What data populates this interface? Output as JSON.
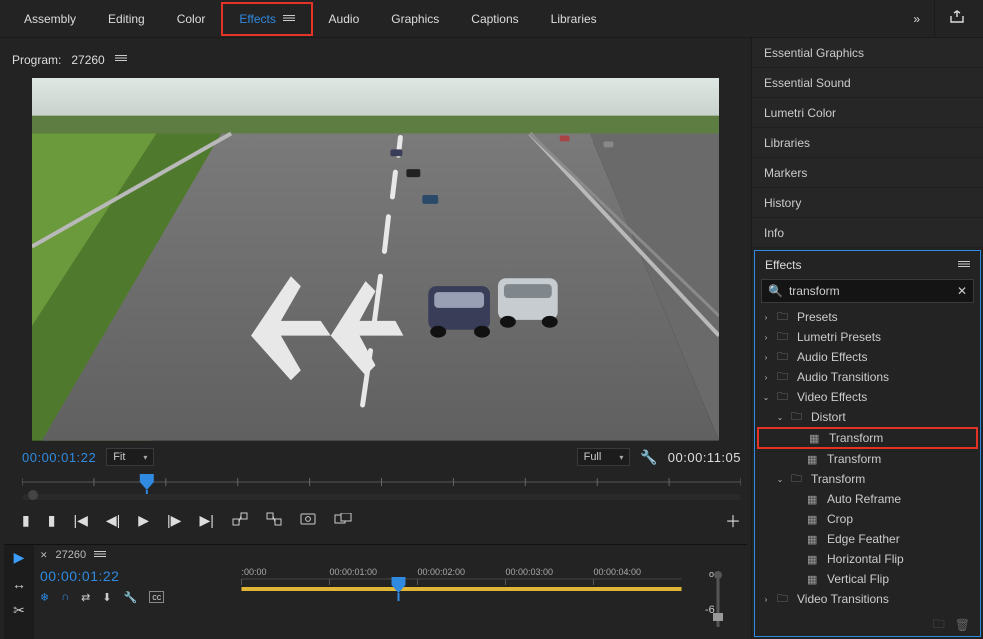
{
  "workspace_tabs": {
    "assembly": "Assembly",
    "editing": "Editing",
    "color": "Color",
    "effects": "Effects",
    "audio": "Audio",
    "graphics": "Graphics",
    "captions": "Captions",
    "libraries": "Libraries"
  },
  "program": {
    "label": "Program:",
    "sequence_name": "27260"
  },
  "monitor_footer": {
    "current_tc": "00:00:01:22",
    "fit_label": "Fit",
    "full_label": "Full",
    "duration_tc": "00:00:11:05"
  },
  "timeline": {
    "seq_name": "27260",
    "playhead_tc": "00:00:01:22",
    "ruler_labels": [
      ":00:00",
      "00:00:01:00",
      "00:00:02:00",
      "00:00:03:00",
      "00:00:04:00"
    ]
  },
  "right_panels": {
    "essential_graphics": "Essential Graphics",
    "essential_sound": "Essential Sound",
    "lumetri_color": "Lumetri Color",
    "libraries": "Libraries",
    "markers": "Markers",
    "history": "History",
    "info": "Info"
  },
  "effects_panel": {
    "title": "Effects",
    "search_value": "transform",
    "tree": {
      "presets": "Presets",
      "lumetri_presets": "Lumetri Presets",
      "audio_effects": "Audio Effects",
      "audio_transitions": "Audio Transitions",
      "video_effects": "Video Effects",
      "distort": "Distort",
      "transform_fx_1": "Transform",
      "transform_fx_2": "Transform",
      "transform_folder": "Transform",
      "auto_reframe": "Auto Reframe",
      "crop": "Crop",
      "edge_feather": "Edge Feather",
      "horizontal_flip": "Horizontal Flip",
      "vertical_flip": "Vertical Flip",
      "video_transitions": "Video Transitions"
    }
  }
}
